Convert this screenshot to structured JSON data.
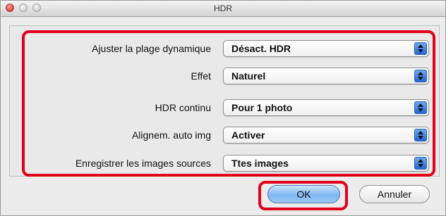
{
  "window": {
    "title": "HDR"
  },
  "settings": [
    {
      "label": "Ajuster la plage dynamique",
      "value": "Désact. HDR"
    },
    {
      "label": "Effet",
      "value": "Naturel"
    },
    {
      "label": "HDR continu",
      "value": "Pour 1 photo"
    },
    {
      "label": "Alignem. auto img",
      "value": "Activer"
    },
    {
      "label": "Enregistrer les images sources",
      "value": "Ttes images"
    }
  ],
  "buttons": {
    "ok": "OK",
    "cancel": "Annuler"
  },
  "colors": {
    "highlight": "#e3001b",
    "default_button": "#7fb6f2",
    "stepper": "#2565d6"
  }
}
